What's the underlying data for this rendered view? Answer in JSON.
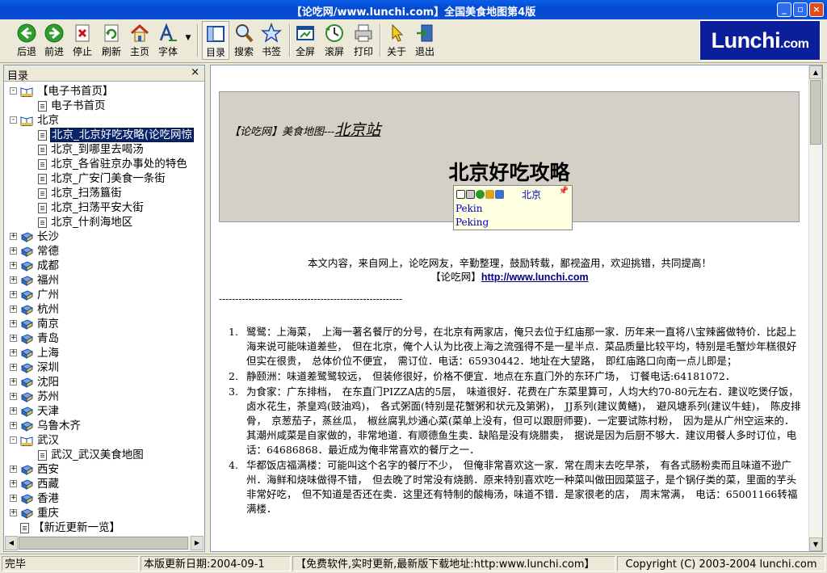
{
  "window": {
    "title": "【论吃网/www.lunchi.com】全国美食地图第4版"
  },
  "toolbar": {
    "buttons": [
      {
        "label": "后退",
        "icon": "back-arrow-icon"
      },
      {
        "label": "前进",
        "icon": "forward-arrow-icon"
      },
      {
        "label": "停止",
        "icon": "stop-icon"
      },
      {
        "label": "刷新",
        "icon": "refresh-icon"
      },
      {
        "label": "主页",
        "icon": "home-icon"
      },
      {
        "label": "字体",
        "icon": "font-icon"
      },
      {
        "label": "目录",
        "icon": "contents-icon"
      },
      {
        "label": "搜索",
        "icon": "search-icon"
      },
      {
        "label": "书签",
        "icon": "bookmark-icon"
      },
      {
        "label": "全屏",
        "icon": "fullscreen-icon"
      },
      {
        "label": "滚屏",
        "icon": "autoscroll-icon"
      },
      {
        "label": "打印",
        "icon": "print-icon"
      },
      {
        "label": "关于",
        "icon": "about-icon"
      },
      {
        "label": "退出",
        "icon": "exit-icon"
      }
    ],
    "logo_main": "Lunchi",
    "logo_suffix": ".com"
  },
  "sidebar": {
    "title": "目录",
    "close": "×",
    "tree": [
      {
        "label": "【电子书首页】",
        "type": "book-open",
        "level": 0,
        "expand": "-"
      },
      {
        "label": "电子书首页",
        "type": "page",
        "level": 1
      },
      {
        "label": "北京",
        "type": "book-open",
        "level": 0,
        "expand": "-"
      },
      {
        "label": "北京_北京好吃攻略(论吃网惊",
        "type": "page",
        "level": 1,
        "selected": true
      },
      {
        "label": "北京_到哪里去喝汤",
        "type": "page",
        "level": 1
      },
      {
        "label": "北京_各省驻京办事处的特色",
        "type": "page",
        "level": 1
      },
      {
        "label": "北京_广安门美食一条街",
        "type": "page",
        "level": 1
      },
      {
        "label": "北京_扫荡簋街",
        "type": "page",
        "level": 1
      },
      {
        "label": "北京_扫荡平安大街",
        "type": "page",
        "level": 1
      },
      {
        "label": "北京_什刹海地区",
        "type": "page",
        "level": 1
      },
      {
        "label": "长沙",
        "type": "book",
        "level": 0,
        "expand": "+"
      },
      {
        "label": "常德",
        "type": "book",
        "level": 0,
        "expand": "+"
      },
      {
        "label": "成都",
        "type": "book",
        "level": 0,
        "expand": "+"
      },
      {
        "label": "福州",
        "type": "book",
        "level": 0,
        "expand": "+"
      },
      {
        "label": "广州",
        "type": "book",
        "level": 0,
        "expand": "+"
      },
      {
        "label": "杭州",
        "type": "book",
        "level": 0,
        "expand": "+"
      },
      {
        "label": "南京",
        "type": "book",
        "level": 0,
        "expand": "+"
      },
      {
        "label": "青岛",
        "type": "book",
        "level": 0,
        "expand": "+"
      },
      {
        "label": "上海",
        "type": "book",
        "level": 0,
        "expand": "+"
      },
      {
        "label": "深圳",
        "type": "book",
        "level": 0,
        "expand": "+"
      },
      {
        "label": "沈阳",
        "type": "book",
        "level": 0,
        "expand": "+"
      },
      {
        "label": "苏州",
        "type": "book",
        "level": 0,
        "expand": "+"
      },
      {
        "label": "天津",
        "type": "book",
        "level": 0,
        "expand": "+"
      },
      {
        "label": "乌鲁木齐",
        "type": "book",
        "level": 0,
        "expand": "+"
      },
      {
        "label": "武汉",
        "type": "book-open",
        "level": 0,
        "expand": "-"
      },
      {
        "label": "武汉_武汉美食地图",
        "type": "page",
        "level": 1
      },
      {
        "label": "西安",
        "type": "book",
        "level": 0,
        "expand": "+"
      },
      {
        "label": "西藏",
        "type": "book",
        "level": 0,
        "expand": "+"
      },
      {
        "label": "香港",
        "type": "book",
        "level": 0,
        "expand": "+"
      },
      {
        "label": "重庆",
        "type": "book",
        "level": 0,
        "expand": "+"
      },
      {
        "label": "【新近更新一览】",
        "type": "page",
        "level": 0
      }
    ]
  },
  "article": {
    "site_prefix": "【论吃网】美食地图---",
    "site_station": "北京站",
    "title": "北京好吃攻略",
    "title_sub": "（",
    "intro": "本文内容，来自网上，论吃网友，辛勤整理，鼓励转载，鄙视盗用，欢迎挑错，共同提高！",
    "site_label": "【论吃网】",
    "site_url": "http://www.lunchi.com",
    "divider": "--------------------------------------------------------",
    "items": [
      {
        "n": "1.",
        "text": "鹭鹭：上海菜，　上海一著名餐厅的分号，在北京有两家店，俺只去位于红庙那一家．历年来一直将八宝辣酱做特价．比起上海来说可能味道差些，　但在北京，俺个人认为比夜上海之流强得不是一星半点．菜品质量比较平均，特别是毛蟹炒年糕很好但实在很贵，　总体价位不便宜，　需订位．电话：65930442．地址在大望路，　即红庙路口向南一点儿即是；"
      },
      {
        "n": "2.",
        "text": "静颐洲：味道差鹭鹭较远，　但装修很好，价格不便宜．地点在东直门外的东环广场，　订餐电话:64181072．"
      },
      {
        "n": "3.",
        "text": "为食家：广东排档，　在东直门PIZZA店的5层，　味道很好．花费在广东菜里算可，人均大约70-80元左右．建议吃煲仔饭，　卤水花生，茶皇鸡(豉油鸡)，　各式粥面(特别是花蟹粥和状元及第粥)，　JJ系列(建议黄鳝)，　避风塘系列(建议牛蛙)，　陈皮排骨，　京葱茄子，蒸丝瓜，　椒丝腐乳炒通心菜(菜单上没有，但可以跟厨师要)．一定要试陈村粉，　因为是从广州空运来的．其潮州咸菜是自家做的，非常地道．有顺德鱼生卖．缺陷是没有烧腊卖，　据说是因为后厨不够大．建议用餐人多时订位，电话：64686868．最近成为俺非常喜欢的餐厅之一．"
      },
      {
        "n": "4.",
        "text": "华都饭店福满楼：可能叫这个名字的餐厅不少，　但俺非常喜欢这一家．常在周末去吃早茶，　有各式肠粉卖而且味道不逊广州．海鲜和烧味做得不错，　但去晚了时常没有烧鹅．原来特别喜欢吃一种菜叫做田园菜篮子，是个锅仔类的菜，里面的芋头非常好吃，　但不知道是否还在卖．这里还有特制的酸梅汤，味道不错．是家很老的店，　周末常满，　电话：65001166转福满楼．"
      }
    ]
  },
  "popup": {
    "word": "北京",
    "line2": "Pekin",
    "line3": "Peking"
  },
  "status": {
    "ready": "完毕",
    "update": "本版更新日期:2004-09-1",
    "promo": "【免费软件,实时更新,最新版下载地址:http:www.lunchi.com】",
    "copyright": "Copyright (C) 2003-2004 lunchi.com"
  }
}
